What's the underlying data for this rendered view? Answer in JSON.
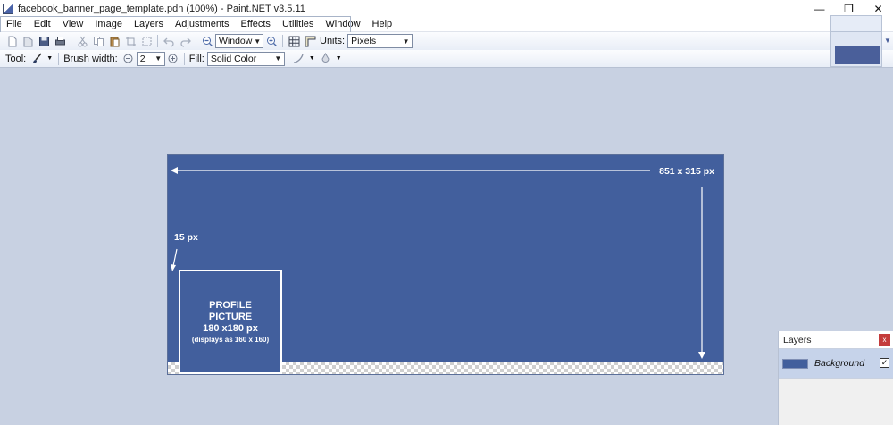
{
  "window": {
    "title": "facebook_banner_page_template.pdn (100%) - Paint.NET v3.5.11",
    "minimize_glyph": "—",
    "restore_glyph": "❐",
    "close_glyph": "✕"
  },
  "menu": {
    "items": [
      "File",
      "Edit",
      "View",
      "Image",
      "Layers",
      "Adjustments",
      "Effects",
      "Utilities",
      "Window",
      "Help"
    ]
  },
  "toolbar1": {
    "zoom_value": "Window",
    "units_label": "Units:",
    "units_value": "Pixels"
  },
  "toolbar2": {
    "tool_label": "Tool:",
    "brush_width_label": "Brush width:",
    "brush_width_value": "2",
    "fill_label": "Fill:",
    "fill_value": "Solid Color"
  },
  "canvas": {
    "dimension_label": "851 x 315 px",
    "margin_label": "15 px",
    "profile": {
      "line1": "PROFILE",
      "line2": "PICTURE",
      "line3": "180 x180 px",
      "line4": "(displays as 160 x 160)"
    }
  },
  "layers": {
    "title": "Layers",
    "close_glyph": "x",
    "items": [
      {
        "name": "Background",
        "visible_glyph": "✓"
      }
    ]
  },
  "colors": {
    "banner_blue": "#425f9d",
    "workspace": "#c8d1e2"
  }
}
